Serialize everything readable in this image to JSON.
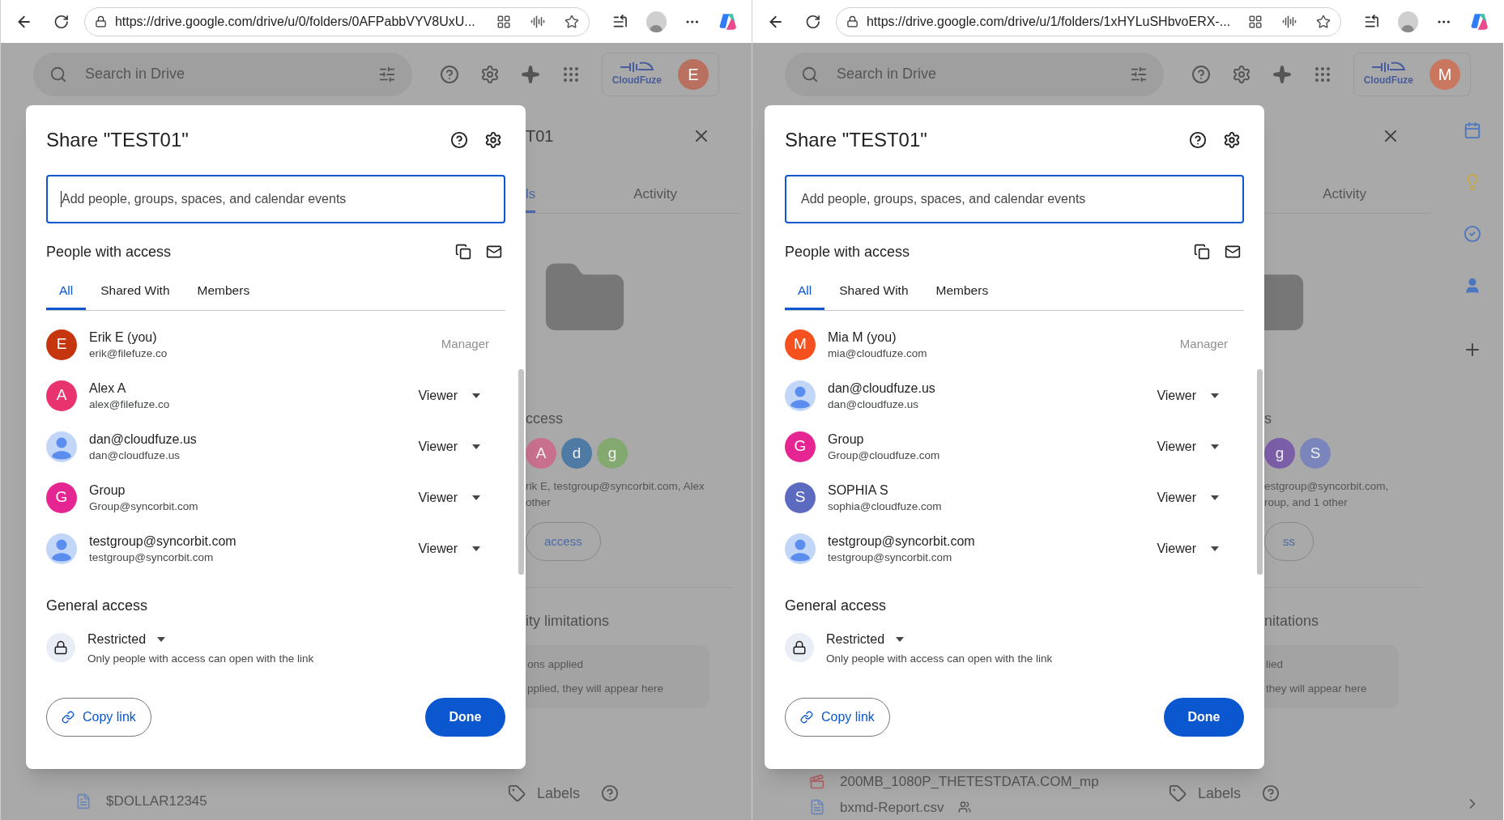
{
  "windows": [
    {
      "url": "https://drive.google.com/drive/u/0/folders/0AFPabbVYV8UxU...",
      "search_placeholder": "Search in Drive",
      "logo": "CloudFuze",
      "account": {
        "letter": "E",
        "color": "#b9705e"
      },
      "side_rail": false,
      "dialog": {
        "title": "Share \"TEST01\"",
        "input_placeholder": "Add people, groups, spaces, and calendar events",
        "input_cursor": true,
        "people_heading": "People with access",
        "tabs": [
          {
            "label": "All",
            "selected": true
          },
          {
            "label": "Shared With",
            "selected": false
          },
          {
            "label": "Members",
            "selected": false
          }
        ],
        "people": [
          {
            "name": "Erik E (you)",
            "email": "erik@filefuze.co",
            "avatar": {
              "kind": "letter",
              "letter": "E",
              "color": "#c5360f"
            },
            "role": "Manager",
            "editable": false
          },
          {
            "name": "Alex A",
            "email": "alex@filefuze.co",
            "avatar": {
              "kind": "letter",
              "letter": "A",
              "color": "#e8336e"
            },
            "role": "Viewer",
            "editable": true
          },
          {
            "name": "dan@cloudfuze.us",
            "email": "dan@cloudfuze.us",
            "avatar": {
              "kind": "silhouette"
            },
            "role": "Viewer",
            "editable": true
          },
          {
            "name": "Group",
            "email": "Group@syncorbit.com",
            "avatar": {
              "kind": "letter",
              "letter": "G",
              "color": "#e52592"
            },
            "role": "Viewer",
            "editable": true
          },
          {
            "name": "testgroup@syncorbit.com",
            "email": "testgroup@syncorbit.com",
            "avatar": {
              "kind": "silhouette"
            },
            "role": "Viewer",
            "editable": true
          }
        ],
        "general_heading": "General access",
        "access_level": "Restricted",
        "access_description": "Only people with access can open with the link",
        "copy_link": "Copy link",
        "done": "Done"
      },
      "details": {
        "title": "T01",
        "tabs": [
          {
            "label": "ls",
            "selected": true
          },
          {
            "label": "Activity",
            "selected": false
          }
        ],
        "access_heading": "ccess",
        "avatars": [
          {
            "letter": "A",
            "color": "#c8708e"
          },
          {
            "letter": "d",
            "color": "#4e7aa4"
          },
          {
            "letter": "g",
            "color": "#83a870"
          }
        ],
        "summary": [
          "rik E, testgroup@syncorbit.com, Alex",
          "other"
        ],
        "access_button": "access",
        "limitations_heading": "ity limitations",
        "limitations_card": [
          "ons applied",
          "pplied, they will appear here"
        ],
        "labels": "Labels"
      },
      "files": [
        {
          "name": "$DOLLAR12345",
          "kind": "doc",
          "shared": false
        }
      ]
    },
    {
      "url": "https://drive.google.com/drive/u/1/folders/1xHYLuSHbvoERX-...",
      "search_placeholder": "Search in Drive",
      "logo": "CloudFuze",
      "account": {
        "letter": "M",
        "color": "#c9775f"
      },
      "side_rail": true,
      "dialog": {
        "title": "Share \"TEST01\"",
        "input_placeholder": "Add people, groups, spaces, and calendar events",
        "input_cursor": false,
        "people_heading": "People with access",
        "tabs": [
          {
            "label": "All",
            "selected": true
          },
          {
            "label": "Shared With",
            "selected": false
          },
          {
            "label": "Members",
            "selected": false
          }
        ],
        "people": [
          {
            "name": "Mia M (you)",
            "email": "mia@cloudfuze.com",
            "avatar": {
              "kind": "letter",
              "letter": "M",
              "color": "#f4511e"
            },
            "role": "Manager",
            "editable": false
          },
          {
            "name": "dan@cloudfuze.us",
            "email": "dan@cloudfuze.us",
            "avatar": {
              "kind": "silhouette"
            },
            "role": "Viewer",
            "editable": true
          },
          {
            "name": "Group",
            "email": "Group@cloudfuze.com",
            "avatar": {
              "kind": "letter",
              "letter": "G",
              "color": "#e52592"
            },
            "role": "Viewer",
            "editable": true
          },
          {
            "name": "SOPHIA S",
            "email": "sophia@cloudfuze.com",
            "avatar": {
              "kind": "letter",
              "letter": "S",
              "color": "#5c6bc0"
            },
            "role": "Viewer",
            "editable": true
          },
          {
            "name": "testgroup@syncorbit.com",
            "email": "testgroup@syncorbit.com",
            "avatar": {
              "kind": "silhouette"
            },
            "role": "Viewer",
            "editable": true
          }
        ],
        "general_heading": "General access",
        "access_level": "Restricted",
        "access_description": "Only people with access can open with the link",
        "copy_link": "Copy link",
        "done": "Done"
      },
      "details": {
        "tabs": [
          {
            "label": "Activity",
            "selected": false
          }
        ],
        "access_heading": "s",
        "avatars": [
          {
            "letter": "g",
            "color": "#7b5ea8"
          },
          {
            "letter": "S",
            "color": "#7a86bb"
          }
        ],
        "summary": [
          "estgroup@syncorbit.com,",
          "roup, and 1 other"
        ],
        "access_button": "ss",
        "limitations_heading": "nitations",
        "limitations_card": [
          "lied",
          "they will appear here"
        ],
        "labels": "Labels"
      },
      "files": [
        {
          "name": "200MB_1080P_THETESTDATA.COM_mp",
          "kind": "video",
          "shared": false
        },
        {
          "name": "bxmd-Report.csv",
          "kind": "doc",
          "shared": true
        }
      ]
    }
  ]
}
